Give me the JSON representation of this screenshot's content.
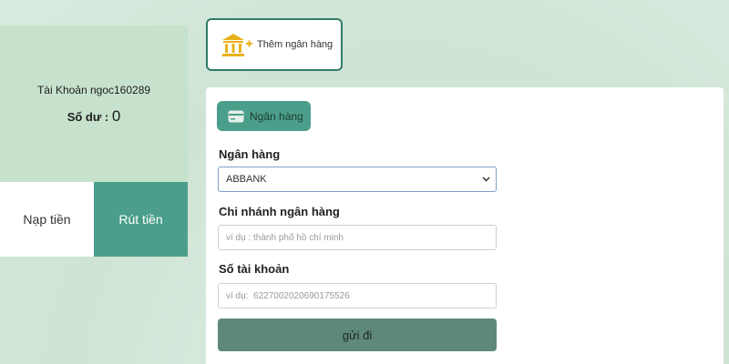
{
  "account": {
    "label": "Tài Khoản ngoc160289",
    "balance_label": "Số dư : ",
    "balance_value": "0"
  },
  "tabs": [
    {
      "label": "Nạp tiền",
      "active": false
    },
    {
      "label": "Rút tiền",
      "active": true
    }
  ],
  "add_bank": {
    "label": "Thêm ngân hàng",
    "icon": "bank-add-icon",
    "icon_color": "#e9b21b"
  },
  "form": {
    "section_label": "Ngân hàng",
    "section_icon": "bank-card-icon",
    "bank_field": {
      "label": "Ngân hàng",
      "selected": "ABBANK"
    },
    "branch_field": {
      "label": "Chi nhánh ngân hàng",
      "placeholder": "ví dụ : thành phố hồ chí minh"
    },
    "account_field": {
      "label": "Số tài khoản",
      "placeholder": "ví dụ:  6227002020690175526"
    },
    "submit_label": "gửi đi"
  },
  "colors": {
    "accent": "#4a9e8a",
    "panel_green": "#c6e2cc",
    "button": "#5e887a",
    "border": "#2f7c68"
  }
}
